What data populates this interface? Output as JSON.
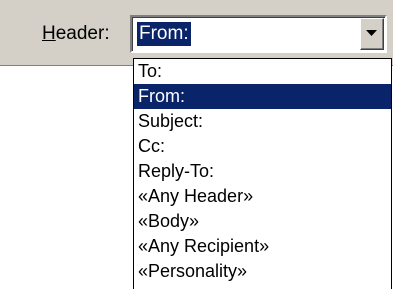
{
  "header_field": {
    "label_accel": "H",
    "label_rest": "eader:",
    "selected_value": "From:"
  },
  "dropdown": {
    "items": [
      {
        "label": "To:",
        "selected": false
      },
      {
        "label": "From:",
        "selected": true
      },
      {
        "label": "Subject:",
        "selected": false
      },
      {
        "label": "Cc:",
        "selected": false
      },
      {
        "label": "Reply-To:",
        "selected": false
      },
      {
        "label": "«Any Header»",
        "selected": false
      },
      {
        "label": "«Body»",
        "selected": false
      },
      {
        "label": "«Any Recipient»",
        "selected": false
      },
      {
        "label": "«Personality»",
        "selected": false
      }
    ]
  },
  "icons": {
    "dropdown_button": "chevron-down-icon"
  },
  "colors": {
    "highlight": "#0a246a",
    "highlight_text": "#ffffff",
    "face": "#d4d0c8"
  }
}
